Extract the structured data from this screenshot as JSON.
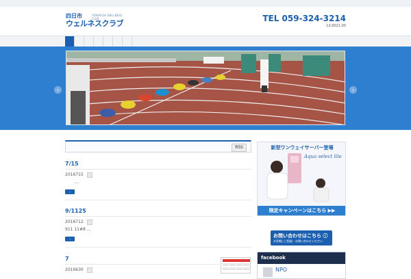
{
  "header": {
    "logo_small": "四日市",
    "logo_main": "ウェルネスクラブ",
    "logo_tag": "YOKKAICHI WELLNESS CLUB",
    "tel": "TEL 059-324-3214",
    "hours": "12:0021:00"
  },
  "slider": {
    "prev_label": "‹",
    "next_label": "›"
  },
  "blog": {
    "rss_label": "RSS",
    "posts": [
      {
        "title": "7/15",
        "date": "2016715",
        "excerpt": "…"
      },
      {
        "title": "9/1125",
        "date": "2016712",
        "excerpt": "911  11#8 …"
      },
      {
        "title": "7",
        "date": "2016630"
      }
    ],
    "more_label": "›"
  },
  "sidebar": {
    "ad_top": "新型ワンウェイサーバー登場",
    "ad_brand": "Aqua select lite",
    "ad_bottom": "限定キャンペーンはこちら ▶▶",
    "contact_main": "お問い合わせはこちら ⓘ",
    "contact_sub": "お気軽にご相談・お問い合わせください",
    "facebook_title": "facebook",
    "facebook_npo": "NPO"
  },
  "colors": {
    "brand": "#1b5fb0",
    "hero_bg": "#2f7fd0",
    "track": "#9b4a3e"
  }
}
